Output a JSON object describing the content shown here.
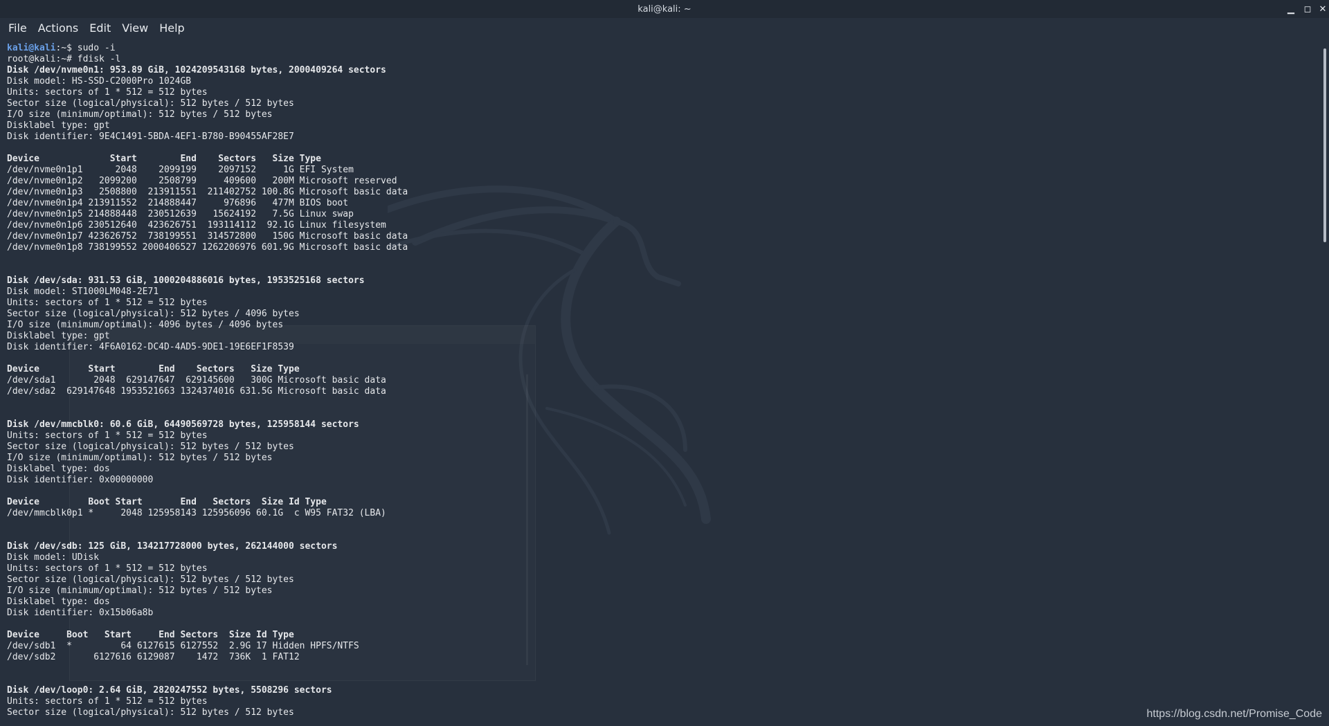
{
  "window": {
    "title": "kali@kali: ~"
  },
  "menu": {
    "items": [
      "File",
      "Actions",
      "Edit",
      "View",
      "Help"
    ]
  },
  "controls": {
    "minimize_glyph": "▁",
    "maximize_glyph": "◻",
    "close_glyph": "✕"
  },
  "terminal": {
    "prompt1_user": "kali@kali",
    "prompt1_rest": ":~$ sudo -i",
    "lines": [
      {
        "t": "root@kali:~# fdisk -l",
        "b": false
      },
      {
        "t": "Disk /dev/nvme0n1: 953.89 GiB, 1024209543168 bytes, 2000409264 sectors",
        "b": true
      },
      {
        "t": "Disk model: HS-SSD-C2000Pro 1024GB",
        "b": false
      },
      {
        "t": "Units: sectors of 1 * 512 = 512 bytes",
        "b": false
      },
      {
        "t": "Sector size (logical/physical): 512 bytes / 512 bytes",
        "b": false
      },
      {
        "t": "I/O size (minimum/optimal): 512 bytes / 512 bytes",
        "b": false
      },
      {
        "t": "Disklabel type: gpt",
        "b": false
      },
      {
        "t": "Disk identifier: 9E4C1491-5BDA-4EF1-B780-B90455AF28E7",
        "b": false
      },
      {
        "t": "",
        "b": false
      },
      {
        "t": "Device             Start        End    Sectors   Size Type",
        "b": true
      },
      {
        "t": "/dev/nvme0n1p1      2048    2099199    2097152     1G EFI System",
        "b": false
      },
      {
        "t": "/dev/nvme0n1p2   2099200    2508799     409600   200M Microsoft reserved",
        "b": false
      },
      {
        "t": "/dev/nvme0n1p3   2508800  213911551  211402752 100.8G Microsoft basic data",
        "b": false
      },
      {
        "t": "/dev/nvme0n1p4 213911552  214888447     976896   477M BIOS boot",
        "b": false
      },
      {
        "t": "/dev/nvme0n1p5 214888448  230512639   15624192   7.5G Linux swap",
        "b": false
      },
      {
        "t": "/dev/nvme0n1p6 230512640  423626751  193114112  92.1G Linux filesystem",
        "b": false
      },
      {
        "t": "/dev/nvme0n1p7 423626752  738199551  314572800   150G Microsoft basic data",
        "b": false
      },
      {
        "t": "/dev/nvme0n1p8 738199552 2000406527 1262206976 601.9G Microsoft basic data",
        "b": false
      },
      {
        "t": "",
        "b": false
      },
      {
        "t": "",
        "b": false
      },
      {
        "t": "Disk /dev/sda: 931.53 GiB, 1000204886016 bytes, 1953525168 sectors",
        "b": true
      },
      {
        "t": "Disk model: ST1000LM048-2E71",
        "b": false
      },
      {
        "t": "Units: sectors of 1 * 512 = 512 bytes",
        "b": false
      },
      {
        "t": "Sector size (logical/physical): 512 bytes / 4096 bytes",
        "b": false
      },
      {
        "t": "I/O size (minimum/optimal): 4096 bytes / 4096 bytes",
        "b": false
      },
      {
        "t": "Disklabel type: gpt",
        "b": false
      },
      {
        "t": "Disk identifier: 4F6A0162-DC4D-4AD5-9DE1-19E6EF1F8539",
        "b": false
      },
      {
        "t": "",
        "b": false
      },
      {
        "t": "Device         Start        End    Sectors   Size Type",
        "b": true
      },
      {
        "t": "/dev/sda1       2048  629147647  629145600   300G Microsoft basic data",
        "b": false
      },
      {
        "t": "/dev/sda2  629147648 1953521663 1324374016 631.5G Microsoft basic data",
        "b": false
      },
      {
        "t": "",
        "b": false
      },
      {
        "t": "",
        "b": false
      },
      {
        "t": "Disk /dev/mmcblk0: 60.6 GiB, 64490569728 bytes, 125958144 sectors",
        "b": true
      },
      {
        "t": "Units: sectors of 1 * 512 = 512 bytes",
        "b": false
      },
      {
        "t": "Sector size (logical/physical): 512 bytes / 512 bytes",
        "b": false
      },
      {
        "t": "I/O size (minimum/optimal): 512 bytes / 512 bytes",
        "b": false
      },
      {
        "t": "Disklabel type: dos",
        "b": false
      },
      {
        "t": "Disk identifier: 0x00000000",
        "b": false
      },
      {
        "t": "",
        "b": false
      },
      {
        "t": "Device         Boot Start       End   Sectors  Size Id Type",
        "b": true
      },
      {
        "t": "/dev/mmcblk0p1 *     2048 125958143 125956096 60.1G  c W95 FAT32 (LBA)",
        "b": false
      },
      {
        "t": "",
        "b": false
      },
      {
        "t": "",
        "b": false
      },
      {
        "t": "Disk /dev/sdb: 125 GiB, 134217728000 bytes, 262144000 sectors",
        "b": true
      },
      {
        "t": "Disk model: UDisk",
        "b": false
      },
      {
        "t": "Units: sectors of 1 * 512 = 512 bytes",
        "b": false
      },
      {
        "t": "Sector size (logical/physical): 512 bytes / 512 bytes",
        "b": false
      },
      {
        "t": "I/O size (minimum/optimal): 512 bytes / 512 bytes",
        "b": false
      },
      {
        "t": "Disklabel type: dos",
        "b": false
      },
      {
        "t": "Disk identifier: 0x15b06a8b",
        "b": false
      },
      {
        "t": "",
        "b": false
      },
      {
        "t": "Device     Boot   Start     End Sectors  Size Id Type",
        "b": true
      },
      {
        "t": "/dev/sdb1  *         64 6127615 6127552  2.9G 17 Hidden HPFS/NTFS",
        "b": false
      },
      {
        "t": "/dev/sdb2       6127616 6129087    1472  736K  1 FAT12",
        "b": false
      },
      {
        "t": "",
        "b": false
      },
      {
        "t": "",
        "b": false
      },
      {
        "t": "Disk /dev/loop0: 2.64 GiB, 2820247552 bytes, 5508296 sectors",
        "b": true
      },
      {
        "t": "Units: sectors of 1 * 512 = 512 bytes",
        "b": false
      },
      {
        "t": "Sector size (logical/physical): 512 bytes / 512 bytes",
        "b": false
      }
    ]
  },
  "watermark": "https://blog.csdn.net/Promise_Code",
  "colors": {
    "background": "#27303d",
    "prompt_user": "#6aa0e8",
    "text": "#e6e8eb"
  }
}
